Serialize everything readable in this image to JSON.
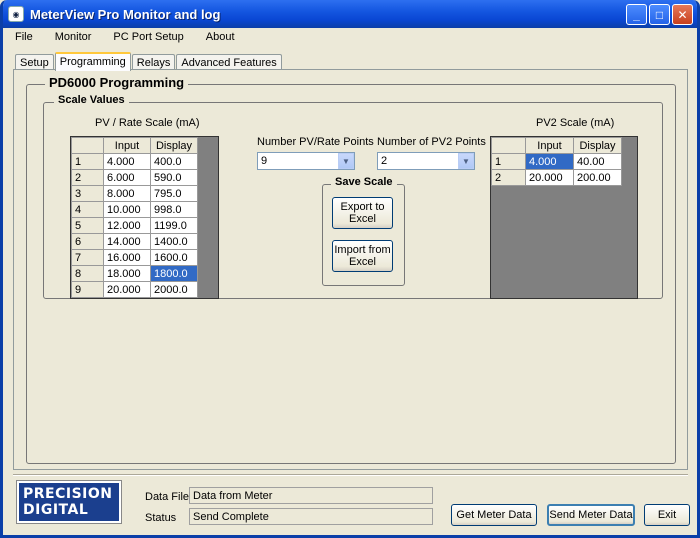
{
  "window": {
    "title": "MeterView Pro Monitor and log",
    "controls": {
      "minimize": "_",
      "maximize": "□",
      "close": "✕"
    }
  },
  "menu": [
    "File",
    "Monitor",
    "PC Port Setup",
    "About"
  ],
  "tabs": [
    {
      "label": "Setup",
      "active": false
    },
    {
      "label": "Programming",
      "active": true
    },
    {
      "label": "Relays",
      "active": false
    },
    {
      "label": "Advanced Features",
      "active": false
    }
  ],
  "programming": {
    "group_title": "PD6000 Programming",
    "scale_group_title": "Scale Values",
    "pv_scale": {
      "title": "PV / Rate Scale (mA)",
      "columns": [
        "Input",
        "Display"
      ],
      "rows": [
        {
          "n": "1",
          "input": "4.000",
          "display": "400.0"
        },
        {
          "n": "2",
          "input": "6.000",
          "display": "590.0"
        },
        {
          "n": "3",
          "input": "8.000",
          "display": "795.0"
        },
        {
          "n": "4",
          "input": "10.000",
          "display": "998.0"
        },
        {
          "n": "5",
          "input": "12.000",
          "display": "1199.0"
        },
        {
          "n": "6",
          "input": "14.000",
          "display": "1400.0"
        },
        {
          "n": "7",
          "input": "16.000",
          "display": "1600.0"
        },
        {
          "n": "8",
          "input": "18.000",
          "display": "1800.0"
        },
        {
          "n": "9",
          "input": "20.000",
          "display": "2000.0"
        }
      ]
    },
    "pv_points": {
      "label": "Number PV/Rate Points",
      "value": "9"
    },
    "pv2_points": {
      "label": "Number of PV2 Points",
      "value": "2"
    },
    "save_scale": {
      "title": "Save Scale",
      "export_label": "Export to Excel",
      "import_label": "Import from Excel"
    },
    "pv2_scale": {
      "title": "PV2 Scale (mA)",
      "columns": [
        "Input",
        "Display"
      ],
      "rows": [
        {
          "n": "1",
          "input": "4.000",
          "display": "40.00"
        },
        {
          "n": "2",
          "input": "20.000",
          "display": "200.00"
        }
      ]
    }
  },
  "footer": {
    "logo_line1": "PRECISION",
    "logo_line2": "DIGITAL",
    "data_file_label": "Data File",
    "data_file_value": "Data from Meter",
    "status_label": "Status",
    "status_value": "Send Complete",
    "get_button": "Get Meter Data",
    "send_button": "Send Meter Data",
    "exit_button": "Exit"
  }
}
